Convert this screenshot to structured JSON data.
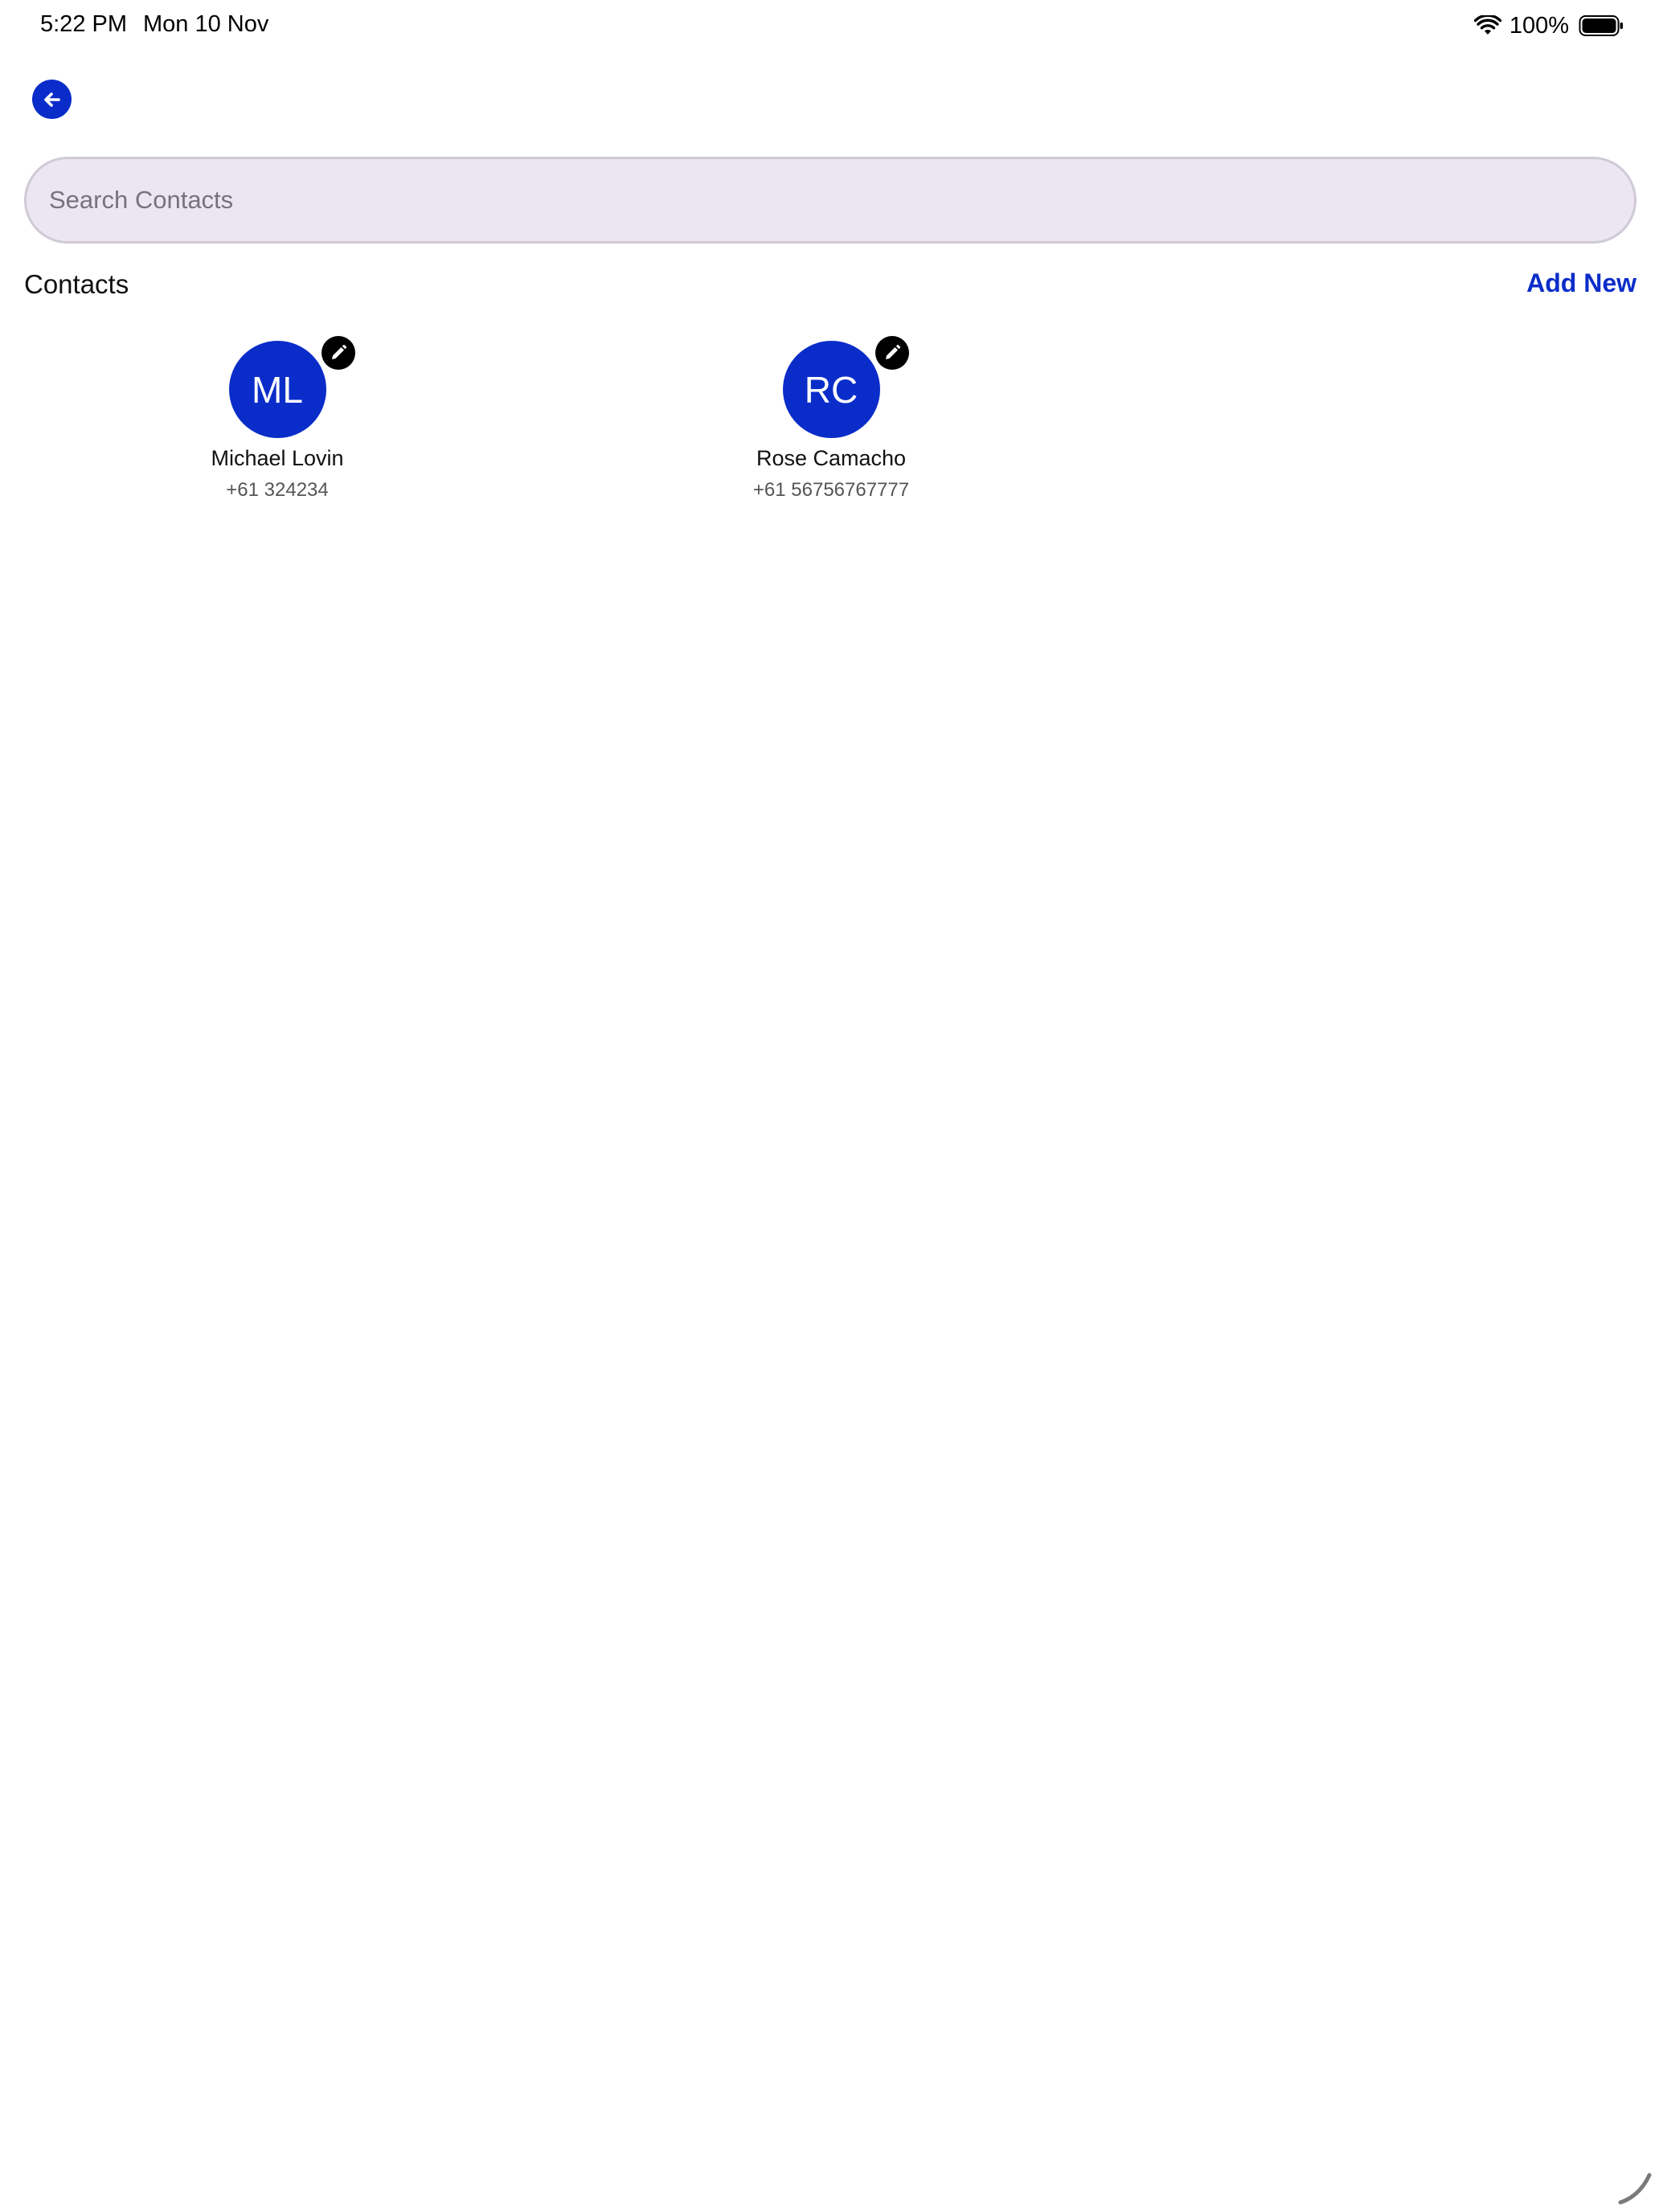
{
  "status_bar": {
    "time": "5:22 PM",
    "date": "Mon 10 Nov",
    "battery": "100%",
    "icons": [
      "wifi-icon",
      "battery-icon"
    ]
  },
  "header": {
    "back_icon": "arrow-left-icon"
  },
  "search": {
    "placeholder": "Search Contacts",
    "value": ""
  },
  "contacts_section": {
    "title": "Contacts",
    "add_new_label": "Add New",
    "contacts": [
      {
        "initials": "ML",
        "name": "Michael Lovin",
        "phone": "+61 324234",
        "edit_icon": "pencil-icon"
      },
      {
        "initials": "RC",
        "name": "Rose Camacho",
        "phone": "+61 56756767777",
        "edit_icon": "pencil-icon"
      }
    ]
  },
  "colors": {
    "accent": "#0a2dc9",
    "search_background": "#ebe6f1",
    "search_border": "#cfcad6",
    "edit_badge": "#000000"
  }
}
